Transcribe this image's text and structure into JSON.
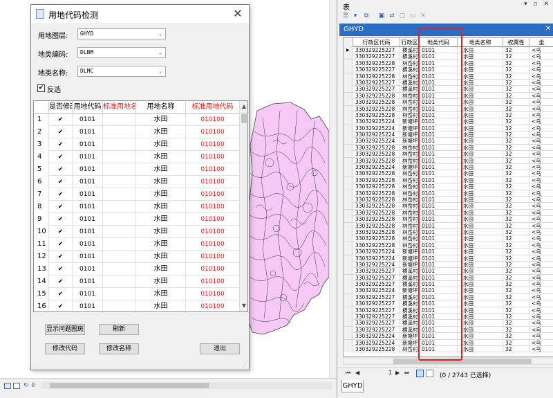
{
  "dialog": {
    "title": "用地代码检测",
    "layer_label": "用地图层:",
    "layer_value": "GHYD",
    "code_label": "地类编码:",
    "code_value": "DLBM",
    "name_label": "地类名称:",
    "name_value": "DLMC",
    "invert_label": "反选",
    "invert_checked": "✔",
    "columns": [
      "是否修改",
      "用地代码",
      "标准用地名称",
      "用地名称",
      "标准用地代码"
    ],
    "rows": [
      {
        "idx": "1",
        "code": "0101",
        "name": "水田",
        "std_code": "010100"
      },
      {
        "idx": "2",
        "code": "0101",
        "name": "水田",
        "std_code": "010100"
      },
      {
        "idx": "3",
        "code": "0101",
        "name": "水田",
        "std_code": "010100"
      },
      {
        "idx": "4",
        "code": "0101",
        "name": "水田",
        "std_code": "010100"
      },
      {
        "idx": "5",
        "code": "0101",
        "name": "水田",
        "std_code": "010100"
      },
      {
        "idx": "6",
        "code": "0101",
        "name": "水田",
        "std_code": "010100"
      },
      {
        "idx": "7",
        "code": "0101",
        "name": "水田",
        "std_code": "010100"
      },
      {
        "idx": "8",
        "code": "0101",
        "name": "水田",
        "std_code": "010100"
      },
      {
        "idx": "9",
        "code": "0101",
        "name": "水田",
        "std_code": "010100"
      },
      {
        "idx": "10",
        "code": "0101",
        "name": "水田",
        "std_code": "010100"
      },
      {
        "idx": "11",
        "code": "0101",
        "name": "水田",
        "std_code": "010100"
      },
      {
        "idx": "12",
        "code": "0101",
        "name": "水田",
        "std_code": "010100"
      },
      {
        "idx": "13",
        "code": "0101",
        "name": "水田",
        "std_code": "010100"
      },
      {
        "idx": "14",
        "code": "0101",
        "name": "水田",
        "std_code": "010100"
      },
      {
        "idx": "15",
        "code": "0101",
        "name": "水田",
        "std_code": "010100"
      },
      {
        "idx": "16",
        "code": "0101",
        "name": "水田",
        "std_code": "010100"
      }
    ],
    "buttons": {
      "show_problem": "显示问题图斑",
      "refresh": "刷新",
      "modify_code": "修改代码",
      "modify_name": "修改名称",
      "exit": "退出"
    }
  },
  "table_panel": {
    "title": "表",
    "layer_tab": "GHYD",
    "columns": [
      "行政区代码",
      "行政区",
      "地类代码",
      "地类名称",
      "权属性",
      "坐"
    ],
    "rows": [
      {
        "xzq": "330329225227",
        "xzqm": "横溪村",
        "dldm": "0101",
        "dlmc": "水田",
        "qsx": "32",
        "more": "<乌"
      },
      {
        "xzq": "330329225227",
        "xzqm": "横溪村",
        "dldm": "0101",
        "dlmc": "水田",
        "qsx": "32",
        "more": "<乌"
      },
      {
        "xzq": "330329225228",
        "xzqm": "林岙村",
        "dldm": "0101",
        "dlmc": "水田",
        "qsx": "32",
        "more": "<乌"
      },
      {
        "xzq": "330329225227",
        "xzqm": "横溪村",
        "dldm": "0101",
        "dlmc": "水田",
        "qsx": "32",
        "more": "<乌"
      },
      {
        "xzq": "330329225228",
        "xzqm": "林岙村",
        "dldm": "0101",
        "dlmc": "水田",
        "qsx": "32",
        "more": "<乌"
      },
      {
        "xzq": "330329225227",
        "xzqm": "横溪村",
        "dldm": "0101",
        "dlmc": "水田",
        "qsx": "32",
        "more": "<乌"
      },
      {
        "xzq": "330329225227",
        "xzqm": "横溪村",
        "dldm": "0101",
        "dlmc": "水田",
        "qsx": "32",
        "more": "<乌"
      },
      {
        "xzq": "330329225228",
        "xzqm": "林岙村",
        "dldm": "0101",
        "dlmc": "水田",
        "qsx": "32",
        "more": "<乌"
      },
      {
        "xzq": "330329225228",
        "xzqm": "林岙村",
        "dldm": "0101",
        "dlmc": "水田",
        "qsx": "32",
        "more": "<乌"
      },
      {
        "xzq": "330329225228",
        "xzqm": "林岙村",
        "dldm": "0101",
        "dlmc": "水田",
        "qsx": "32",
        "more": "<乌"
      },
      {
        "xzq": "330329225228",
        "xzqm": "林岙村",
        "dldm": "0101",
        "dlmc": "水田",
        "qsx": "32",
        "more": "<乌"
      },
      {
        "xzq": "330329225224",
        "xzqm": "新塘坪",
        "dldm": "0101",
        "dlmc": "水田",
        "qsx": "32",
        "more": "<乌"
      },
      {
        "xzq": "330329225224",
        "xzqm": "新塘坪",
        "dldm": "0101",
        "dlmc": "水田",
        "qsx": "32",
        "more": "<乌"
      },
      {
        "xzq": "330329225224",
        "xzqm": "新塘坪",
        "dldm": "0101",
        "dlmc": "水田",
        "qsx": "32",
        "more": "<乌"
      },
      {
        "xzq": "330329225224",
        "xzqm": "新塘坪",
        "dldm": "0101",
        "dlmc": "水田",
        "qsx": "32",
        "more": "<乌"
      },
      {
        "xzq": "330329225228",
        "xzqm": "林岙村",
        "dldm": "0101",
        "dlmc": "水田",
        "qsx": "32",
        "more": "<乌"
      },
      {
        "xzq": "330329225228",
        "xzqm": "林岙村",
        "dldm": "0101",
        "dlmc": "水田",
        "qsx": "32",
        "more": "<乌"
      },
      {
        "xzq": "330329225228",
        "xzqm": "林岙村",
        "dldm": "0101",
        "dlmc": "水田",
        "qsx": "32",
        "more": "<乌"
      },
      {
        "xzq": "330329225224",
        "xzqm": "新塘坪",
        "dldm": "0101",
        "dlmc": "水田",
        "qsx": "32",
        "more": "<乌"
      },
      {
        "xzq": "330329225228",
        "xzqm": "林岙村",
        "dldm": "0101",
        "dlmc": "水田",
        "qsx": "32",
        "more": "<乌"
      },
      {
        "xzq": "330329225228",
        "xzqm": "林岙村",
        "dldm": "0101",
        "dlmc": "水田",
        "qsx": "32",
        "more": "<乌"
      },
      {
        "xzq": "330329225228",
        "xzqm": "林岙村",
        "dldm": "0101",
        "dlmc": "水田",
        "qsx": "32",
        "more": "<乌"
      },
      {
        "xzq": "330329225228",
        "xzqm": "林岙村",
        "dldm": "0101",
        "dlmc": "水田",
        "qsx": "32",
        "more": "<乌"
      },
      {
        "xzq": "330329225228",
        "xzqm": "林岙村",
        "dldm": "0101",
        "dlmc": "水田",
        "qsx": "32",
        "more": "<乌"
      },
      {
        "xzq": "330329225228",
        "xzqm": "林岙村",
        "dldm": "0101",
        "dlmc": "水田",
        "qsx": "32",
        "more": "<乌"
      },
      {
        "xzq": "330329225228",
        "xzqm": "林岙村",
        "dldm": "0101",
        "dlmc": "水田",
        "qsx": "32",
        "more": "<乌"
      },
      {
        "xzq": "330329225228",
        "xzqm": "林岙村",
        "dldm": "0101",
        "dlmc": "水田",
        "qsx": "32",
        "more": "<乌"
      },
      {
        "xzq": "330329225228",
        "xzqm": "林岙村",
        "dldm": "0101",
        "dlmc": "水田",
        "qsx": "32",
        "more": "<乌"
      },
      {
        "xzq": "330329225228",
        "xzqm": "林岙村",
        "dldm": "0101",
        "dlmc": "水田",
        "qsx": "32",
        "more": "<乌"
      },
      {
        "xzq": "330329225228",
        "xzqm": "林岙村",
        "dldm": "0101",
        "dlmc": "水田",
        "qsx": "32",
        "more": "<乌"
      },
      {
        "xzq": "330329225228",
        "xzqm": "林岙村",
        "dldm": "0101",
        "dlmc": "水田",
        "qsx": "32",
        "more": "<乌"
      },
      {
        "xzq": "330329225224",
        "xzqm": "新塘坪",
        "dldm": "0101",
        "dlmc": "水田",
        "qsx": "32",
        "more": "<乌"
      },
      {
        "xzq": "330329225224",
        "xzqm": "新塘坪",
        "dldm": "0101",
        "dlmc": "水田",
        "qsx": "32",
        "more": "<乌"
      },
      {
        "xzq": "330329225224",
        "xzqm": "新塘坪",
        "dldm": "0101",
        "dlmc": "水田",
        "qsx": "32",
        "more": "<乌"
      },
      {
        "xzq": "330329225227",
        "xzqm": "横溪村",
        "dldm": "0101",
        "dlmc": "水田",
        "qsx": "32",
        "more": "<乌"
      },
      {
        "xzq": "330329225227",
        "xzqm": "横溪村",
        "dldm": "0101",
        "dlmc": "水田",
        "qsx": "32",
        "more": "<乌"
      },
      {
        "xzq": "330329225227",
        "xzqm": "横溪村",
        "dldm": "0101",
        "dlmc": "水田",
        "qsx": "32",
        "more": "<乌"
      },
      {
        "xzq": "330329225224",
        "xzqm": "新塘坪",
        "dldm": "0101",
        "dlmc": "水田",
        "qsx": "32",
        "more": "<乌"
      },
      {
        "xzq": "330329225227",
        "xzqm": "横溪村",
        "dldm": "0101",
        "dlmc": "水田",
        "qsx": "32",
        "more": "<乌"
      },
      {
        "xzq": "330329225227",
        "xzqm": "横溪村",
        "dldm": "0101",
        "dlmc": "水田",
        "qsx": "32",
        "more": "<乌"
      },
      {
        "xzq": "330329225227",
        "xzqm": "横溪村",
        "dldm": "0101",
        "dlmc": "水田",
        "qsx": "32",
        "more": "<乌"
      },
      {
        "xzq": "330329225227",
        "xzqm": "横溪村",
        "dldm": "0101",
        "dlmc": "水田",
        "qsx": "32",
        "more": "<乌"
      },
      {
        "xzq": "330329225227",
        "xzqm": "横溪村",
        "dldm": "0101",
        "dlmc": "水田",
        "qsx": "32",
        "more": "<乌"
      },
      {
        "xzq": "330329225227",
        "xzqm": "横溪村",
        "dldm": "0101",
        "dlmc": "水田",
        "qsx": "32",
        "more": "<乌"
      },
      {
        "xzq": "330329225224",
        "xzqm": "新塘坪",
        "dldm": "0101",
        "dlmc": "水田",
        "qsx": "32",
        "more": "<乌"
      },
      {
        "xzq": "330329225224",
        "xzqm": "新塘坪",
        "dldm": "0101",
        "dlmc": "水田",
        "qsx": "32",
        "more": "<乌"
      },
      {
        "xzq": "330329225228",
        "xzqm": "林岙村",
        "dldm": "0101",
        "dlmc": "水田",
        "qsx": "32",
        "more": "<乌"
      }
    ],
    "nav_page": "1",
    "status": "(0 / 2743 已选择)",
    "bottom_tab": "GHYD"
  },
  "colors": {
    "map_fill": "#f5c8f5",
    "accent_red": "#ee1111",
    "layer_bar": "#2b6cc4"
  }
}
